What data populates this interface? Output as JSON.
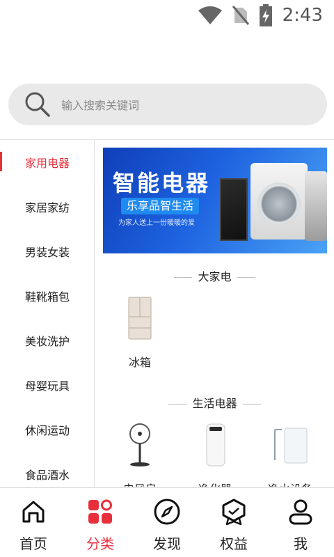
{
  "status_bar": {
    "time": "2:43",
    "icons": [
      "wifi-icon",
      "no-sim-icon",
      "battery-charging-icon"
    ]
  },
  "search": {
    "placeholder": "输入搜索关键词",
    "icon": "search-icon"
  },
  "sidebar": {
    "items": [
      {
        "label": "家用电器",
        "active": true
      },
      {
        "label": "家居家纺",
        "active": false
      },
      {
        "label": "男装女装",
        "active": false
      },
      {
        "label": "鞋靴箱包",
        "active": false
      },
      {
        "label": "美妆洗护",
        "active": false
      },
      {
        "label": "母婴玩具",
        "active": false
      },
      {
        "label": "休闲运动",
        "active": false
      },
      {
        "label": "食品酒水",
        "active": false
      }
    ]
  },
  "banner": {
    "headline": "智能电器",
    "pill": "乐享品智生活",
    "tagline": "为家人送上一份暖暖的爱",
    "brand_color": "#1e63e0"
  },
  "sections": [
    {
      "title": "大家电",
      "items": [
        {
          "label": "冰箱",
          "icon": "fridge-icon"
        }
      ]
    },
    {
      "title": "生活电器",
      "items": [
        {
          "label": "电风扇",
          "icon": "fan-icon"
        },
        {
          "label": "净化器",
          "icon": "air-purifier-icon"
        },
        {
          "label": "净水设备",
          "icon": "water-purifier-icon"
        }
      ]
    }
  ],
  "tabbar": {
    "items": [
      {
        "label": "首页",
        "icon": "home-icon",
        "active": false
      },
      {
        "label": "分类",
        "icon": "category-icon",
        "active": true
      },
      {
        "label": "发现",
        "icon": "compass-icon",
        "active": false
      },
      {
        "label": "权益",
        "icon": "badge-icon",
        "active": false
      },
      {
        "label": "我",
        "icon": "user-icon",
        "active": false
      }
    ]
  },
  "colors": {
    "accent": "#e8303c",
    "search_bg": "#e9e9e9"
  }
}
